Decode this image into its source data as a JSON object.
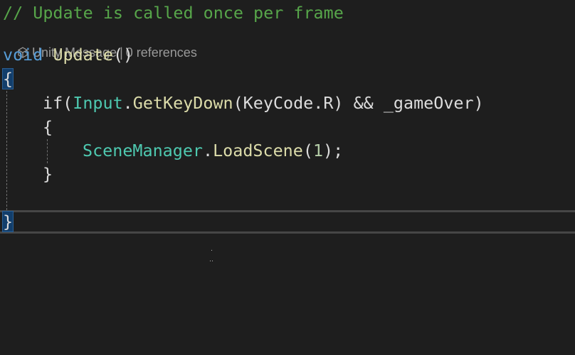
{
  "code": {
    "comment": "// Update is called once per frame",
    "codelens": {
      "message": "Unity Message",
      "separator": "|",
      "references": "0 references"
    },
    "signature": {
      "keyword": "void",
      "method": "Update",
      "parens": "()"
    },
    "open_brace": "{",
    "if_line": {
      "keyword": "if(",
      "type": "Input",
      "dot": ".",
      "method": "GetKeyDown",
      "args": "(KeyCode.R) && _gameOver)"
    },
    "inner_open_brace": "{",
    "load_line": {
      "type": "SceneManager",
      "dot": ".",
      "method": "LoadScene",
      "open": "(",
      "number": "1",
      "close": ");"
    },
    "inner_close_brace": "}",
    "close_brace": "}"
  },
  "colors": {
    "background": "#1e1e1e",
    "comment": "#57a64a",
    "keyword": "#569cd6",
    "type": "#4ec9b0",
    "method": "#dcdcaa",
    "text": "#dcdcdc",
    "number": "#b5cea8"
  },
  "icons": {
    "codelens": "unity-cube-icon"
  }
}
